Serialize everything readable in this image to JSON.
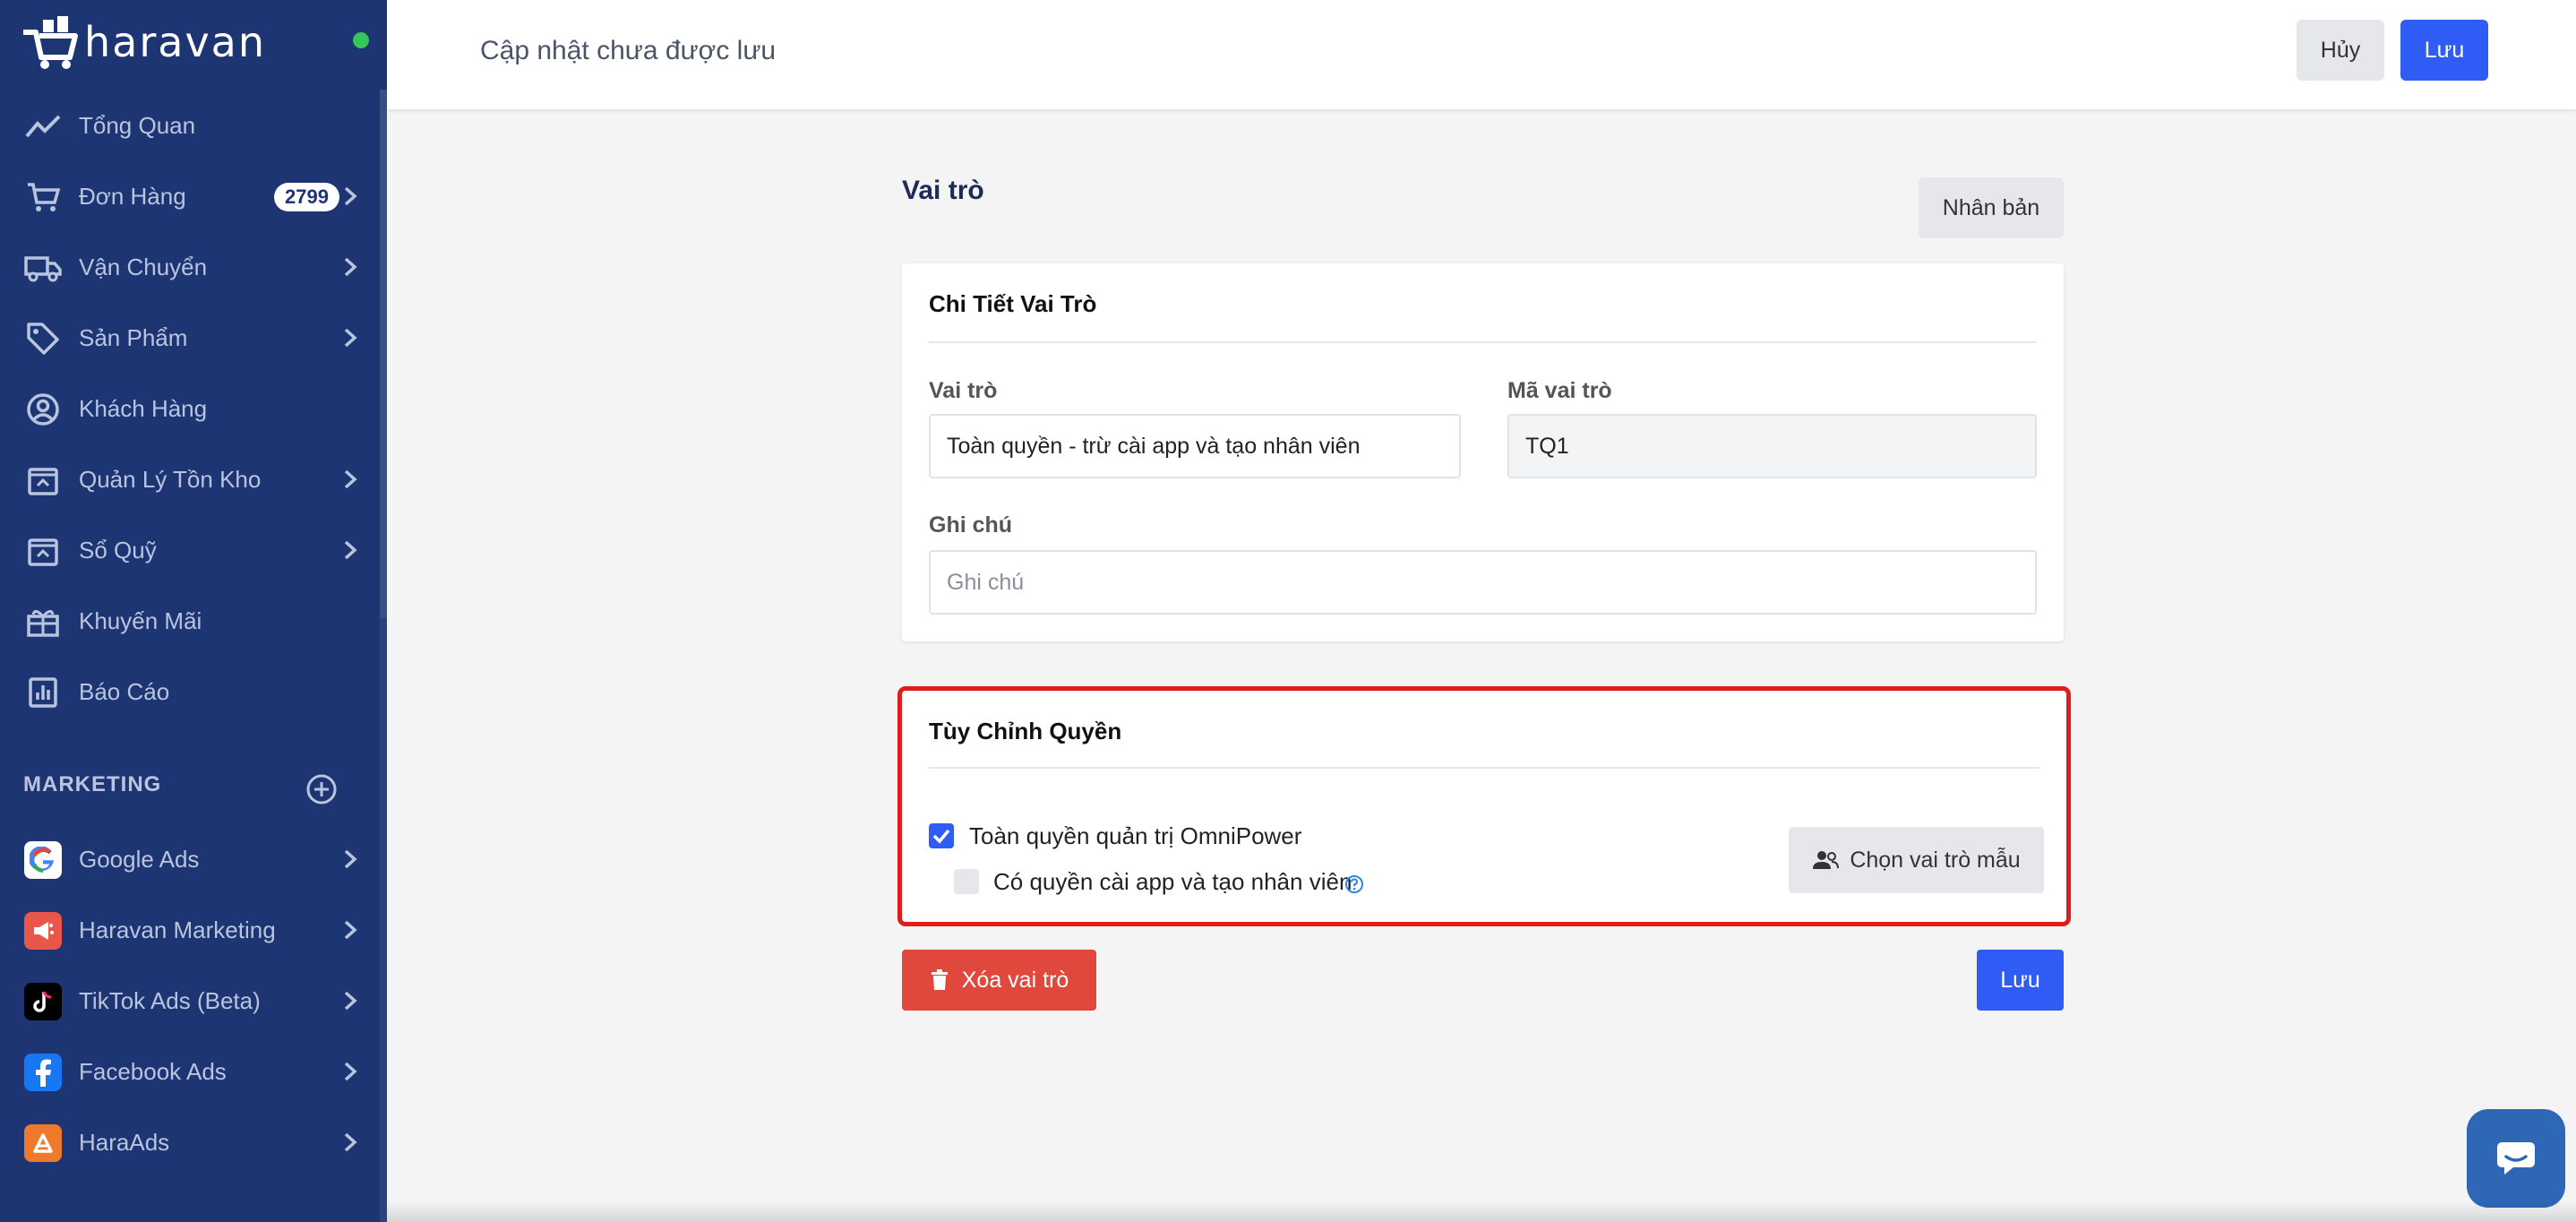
{
  "brand": {
    "name": "haravan"
  },
  "sidebar": {
    "items": [
      {
        "label": "Tổng Quan",
        "icon": "trend-icon"
      },
      {
        "label": "Đơn Hàng",
        "icon": "cart-icon",
        "badge": "2799"
      },
      {
        "label": "Vận Chuyển",
        "icon": "truck-icon"
      },
      {
        "label": "Sản Phẩm",
        "icon": "tag-icon"
      },
      {
        "label": "Khách Hàng",
        "icon": "user-circle-icon"
      },
      {
        "label": "Quản Lý Tồn Kho",
        "icon": "inventory-icon"
      },
      {
        "label": "Sổ Quỹ",
        "icon": "cashbook-icon"
      },
      {
        "label": "Khuyến Mãi",
        "icon": "gift-icon"
      },
      {
        "label": "Báo Cáo",
        "icon": "report-icon"
      }
    ],
    "marketing_label": "MARKETING",
    "apps": [
      {
        "label": "Google Ads",
        "icon": "google-icon"
      },
      {
        "label": "Haravan Marketing",
        "icon": "megaphone-icon"
      },
      {
        "label": "TikTok Ads (Beta)",
        "icon": "tiktok-icon"
      },
      {
        "label": "Facebook Ads",
        "icon": "facebook-icon"
      },
      {
        "label": "HaraAds",
        "icon": "haraads-icon"
      }
    ]
  },
  "topbar": {
    "title": "Cập nhật chưa được lưu",
    "cancel_label": "Hủy",
    "save_label": "Lưu"
  },
  "page": {
    "heading": "Vai trò",
    "duplicate_label": "Nhân bản"
  },
  "details": {
    "title": "Chi Tiết Vai Trò",
    "role_label": "Vai trò",
    "role_value": "Toàn quyền - trừ cài app và tạo nhân viên",
    "code_label": "Mã vai trò",
    "code_value": "TQ1",
    "note_label": "Ghi chú",
    "note_placeholder": "Ghi chú"
  },
  "permissions": {
    "title": "Tùy Chỉnh Quyền",
    "full_admin_label": "Toàn quyền quản trị OmniPower",
    "full_admin_checked": true,
    "install_app_label": "Có quyền cài app và tạo nhân viên",
    "install_app_checked": false,
    "template_button_label": "Chọn vai trò mẫu"
  },
  "actions": {
    "delete_label": "Xóa vai trò",
    "save_label": "Lưu"
  },
  "colors": {
    "sidebar_bg": "#1d3572",
    "primary": "#2f5cf4",
    "danger": "#e0483d",
    "highlight_border": "#e01c1c",
    "online": "#34c759"
  }
}
